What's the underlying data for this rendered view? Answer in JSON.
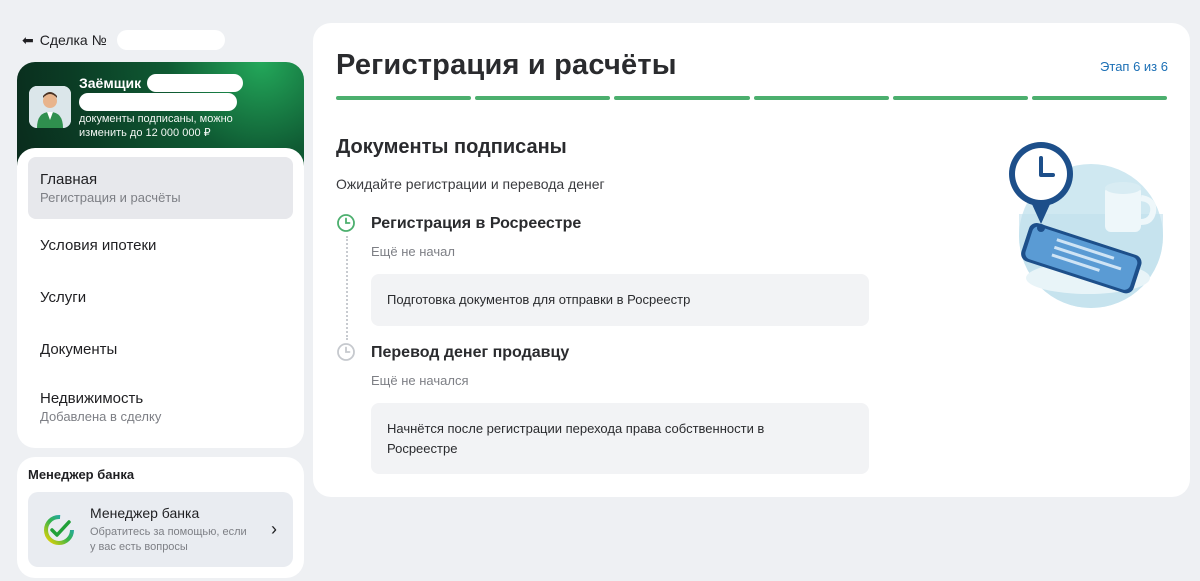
{
  "back": {
    "label": "Сделка №"
  },
  "borrower": {
    "title": "Заёмщик",
    "note": "документы подписаны, можно изменить до 12 000 000 ₽"
  },
  "nav": {
    "items": [
      {
        "label": "Главная",
        "sub": "Регистрация и расчёты"
      },
      {
        "label": "Условия ипотеки"
      },
      {
        "label": "Услуги"
      },
      {
        "label": "Документы"
      },
      {
        "label": "Недвижимость",
        "sub": "Добавлена в сделку"
      }
    ]
  },
  "manager": {
    "section_title": "Менеджер банка",
    "name": "Менеджер банка",
    "desc": "Обратитесь за помощью, если у вас есть вопросы"
  },
  "main": {
    "title": "Регистрация и расчёты",
    "stage": "Этап 6 из 6",
    "progress": {
      "current": 6,
      "total": 6
    },
    "section_title": "Документы подписаны",
    "section_sub": "Ожидайте регистрации и перевода денег",
    "steps": [
      {
        "title": "Регистрация в Росреестре",
        "status": "Ещё не начал",
        "box": "Подготовка документов для отправки в Росреестр"
      },
      {
        "title": "Перевод денег продавцу",
        "status": "Ещё не начался",
        "box": "Начнётся после регистрации перехода права собственности в Росреестре"
      }
    ]
  },
  "colors": {
    "accent_green": "#4caf6e",
    "link_blue": "#1b6fb5",
    "page_bg": "#eef0f3"
  }
}
